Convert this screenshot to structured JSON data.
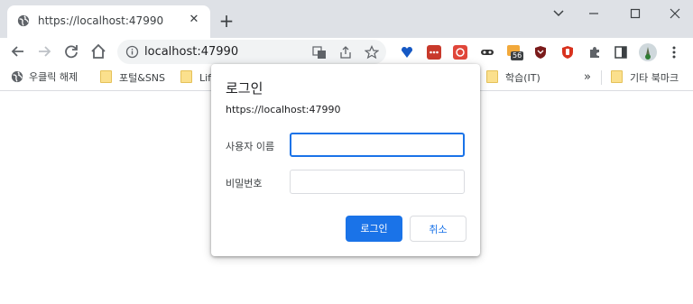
{
  "tab": {
    "title": "https://localhost:47990",
    "close": "✕"
  },
  "toolbar": {
    "url": "localhost:47990"
  },
  "bookmarks": {
    "items": [
      {
        "label": "우클릭 해제"
      },
      {
        "label": "포털&SNS"
      },
      {
        "label": "Lif"
      },
      {
        "label": "학습(IT)"
      },
      {
        "label": "기타 북마크"
      }
    ],
    "overflow": "»"
  },
  "dialog": {
    "title": "로그인",
    "origin": "https://localhost:47990",
    "username_label": "사용자 이름",
    "username_value": "",
    "password_label": "비밀번호",
    "password_value": "",
    "ok_label": "로그인",
    "cancel_label": "취소"
  },
  "extensions": {
    "badge": "56"
  },
  "colors": {
    "accent": "#1a73e8",
    "tabstrip": "#dee1e6"
  }
}
